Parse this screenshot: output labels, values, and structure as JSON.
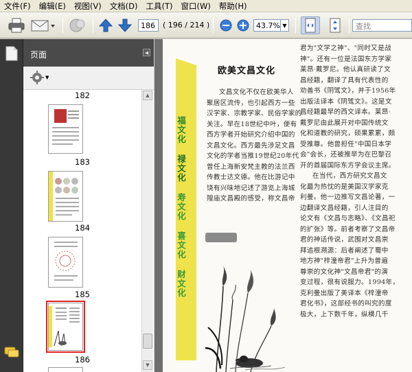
{
  "menu": [
    "文件(F)",
    "编辑(E)",
    "视图(V)",
    "文档(D)",
    "工具(T)",
    "窗口(W)",
    "帮助(H)"
  ],
  "toolbar": {
    "current_page": "186",
    "page_count": "( 196 / 214 )",
    "zoom": "43.7%",
    "search_placeholder": "查找"
  },
  "panel": {
    "title": "页面",
    "thumbnails": [
      {
        "label": "182"
      },
      {
        "label": "183"
      },
      {
        "label": "184"
      },
      {
        "label": "185"
      },
      {
        "label": "186",
        "selected": true
      }
    ]
  },
  "document": {
    "side_labels": [
      "福文化",
      "禄文化",
      "寿文化",
      "喜文化",
      "财文化"
    ],
    "title": "欧美文昌文化",
    "col1": [
      "文昌文化不仅在欧美华人",
      "聚居区流传，也引起西方一些",
      "汉学家、宗教学家、民俗学家的",
      "关注。早在18世纪中叶，便有",
      "西方学者开始研究介绍中国的",
      "文昌文化。西方最先涉足文昌",
      "文化的学者当推19世纪20年代",
      "曾任上海新安梵主教的法兰西",
      "传教士达文德。他在比游记中",
      "饶有兴味地记述了游览上海城",
      "隍庙文昌殿的感受，称文昌帝"
    ],
    "col2": [
      "君为\"文学之神\"、\"同时又是战",
      "神\"。还有一位是法国东方学家",
      "莱昂·戴罗尼。他认真研读了文",
      "昌经籍，翻译了具有代表性的",
      "劝善书《阴骘文》，并于1956年",
      "出版法译本《阴骘文》。这是文",
      "昌经籍最早的西文译本。莱昂·",
      "戴罗尼由此展开对中国传统文",
      "化和道教的研究，硕果累累，颇",
      "受推尊。他曾担任\"中国日本学",
      "会\"会长，还被推举为在巴黎召",
      "开的首届国际东方学会议主席。",
      "在当代，西方研究文昌文",
      "化最为热忱的是美国汉学家克",
      "利曼。他一边推写文昌论著，一",
      "边翻译文昌经籍，引人注目的",
      "论文有《文昌与志略》、《文昌祀",
      "的扩张》等。前者考察了文昌帝",
      "君的神话传说，武围对文昌崇",
      "拜追根溯源：后者阐述了蜀中",
      "地方神\"梓潼帝君\"上升为普遍",
      "尊崇的文化神\"文昌帝君\"的演",
      "变过程，很有说服力。1994年，",
      "克利曼出版了美译本《梓潼帝",
      "君化书》，这部经书的叫究的度",
      "极大，上下数千年，纵横几千"
    ]
  },
  "colors": {
    "accent_yellow": "#f0e64a",
    "selection_red": "#d22222",
    "dark_panel": "#383838"
  }
}
